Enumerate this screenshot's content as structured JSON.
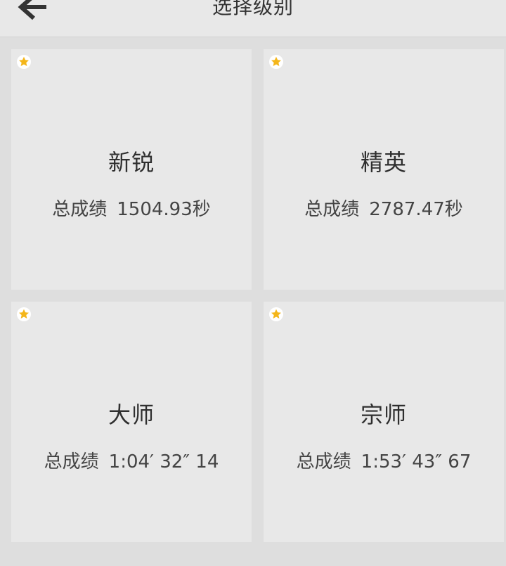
{
  "header": {
    "back_icon": "arrow-left-icon",
    "title": "选择级别"
  },
  "colors": {
    "star": "#f4b61a",
    "card_bg": "#e8e8e8",
    "page_bg": "#dedede"
  },
  "levels": [
    {
      "name": "新锐",
      "score_label": "总成绩",
      "score_value": "1504.93秒"
    },
    {
      "name": "精英",
      "score_label": "总成绩",
      "score_value": "2787.47秒"
    },
    {
      "name": "大师",
      "score_label": "总成绩",
      "score_value": "1:04′ 32″ 14"
    },
    {
      "name": "宗师",
      "score_label": "总成绩",
      "score_value": "1:53′ 43″ 67"
    }
  ]
}
